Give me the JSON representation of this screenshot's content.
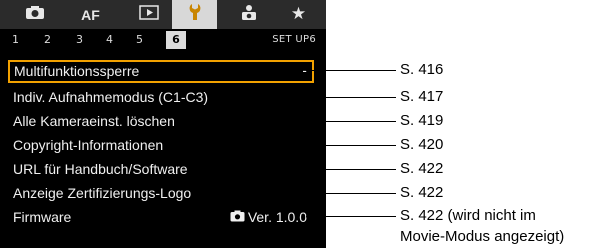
{
  "tabs": [
    {
      "name": "camera-shooting-tab",
      "icon": "camera-icon",
      "glyph": "■",
      "active": false
    },
    {
      "name": "af-tab",
      "icon": "af-text",
      "label": "AF",
      "active": false
    },
    {
      "name": "playback-tab",
      "icon": "playback-icon",
      "glyph": "▶",
      "active": false
    },
    {
      "name": "setup-tab",
      "icon": "wrench-icon",
      "glyph": "🔧",
      "active": true
    },
    {
      "name": "custom-functions-tab",
      "icon": "person-camera-icon",
      "glyph": "🚶",
      "active": false
    },
    {
      "name": "my-menu-tab",
      "icon": "star-icon",
      "glyph": "★",
      "active": false
    }
  ],
  "subtabs": [
    "1",
    "2",
    "3",
    "4",
    "5",
    "6"
  ],
  "active_subtab": "6",
  "setup_label": "SET UP6",
  "menu_items": [
    {
      "label": "Multifunktionssperre",
      "value": "-",
      "selected": true,
      "page": "S. 416"
    },
    {
      "label": "Indiv. Aufnahmemodus (C1-C3)",
      "value": "",
      "selected": false,
      "page": "S. 417"
    },
    {
      "label": "Alle Kameraeinst. löschen",
      "value": "",
      "selected": false,
      "page": "S. 419"
    },
    {
      "label": "Copyright-Informationen",
      "value": "",
      "selected": false,
      "page": "S. 420"
    },
    {
      "label": "URL für Handbuch/Software",
      "value": "",
      "selected": false,
      "page": "S. 422"
    },
    {
      "label": "Anzeige Zertifizierungs-Logo",
      "value": "",
      "selected": false,
      "page": "S. 422"
    },
    {
      "label": "Firmware",
      "value": "Ver. 1.0.0",
      "selected": false,
      "page": "S. 422 (wird nicht im",
      "page_line2": "Movie-Modus angezeigt)"
    }
  ]
}
